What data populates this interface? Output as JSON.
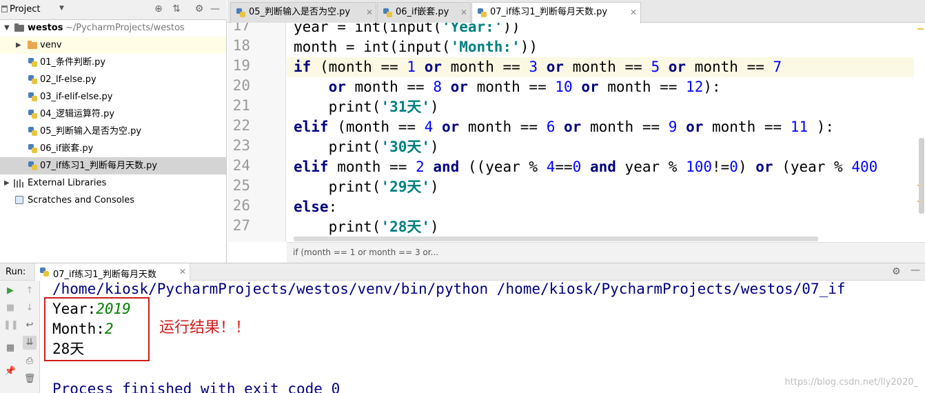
{
  "project_panel": {
    "title": "Project",
    "tree": [
      {
        "label": "westos",
        "suffix": "~/PycharmProjects/westos",
        "kind": "root"
      },
      {
        "label": "venv",
        "kind": "folder"
      },
      {
        "label": "01_条件判断.py",
        "kind": "file"
      },
      {
        "label": "02_lf-else.py",
        "kind": "file"
      },
      {
        "label": "03_if-elif-else.py",
        "kind": "file"
      },
      {
        "label": "04_逻辑运算符.py",
        "kind": "file"
      },
      {
        "label": "05_判断输入是否为空.py",
        "kind": "file"
      },
      {
        "label": "06_if嵌套.py",
        "kind": "file"
      },
      {
        "label": "07_if练习1_判断每月天数.py",
        "kind": "file",
        "selected": true
      },
      {
        "label": "External Libraries",
        "kind": "libraries"
      },
      {
        "label": "Scratches and Consoles",
        "kind": "scratches"
      }
    ]
  },
  "editor": {
    "tabs": [
      {
        "label": "05_判断输入是否为空.py",
        "active": false
      },
      {
        "label": "06_if嵌套.py",
        "active": false
      },
      {
        "label": "07_if练习1_判断每月天数.py",
        "active": true
      }
    ],
    "line_numbers": [
      "17",
      "18",
      "19",
      "20",
      "21",
      "22",
      "23",
      "24",
      "25",
      "26",
      "27"
    ],
    "breadcrumb": "if (month == 1 or month == 3 or..."
  },
  "run_panel": {
    "label": "Run:",
    "tab_label": "07_if练习1_判断每月天数",
    "console": {
      "command": "/home/kiosk/PycharmProjects/westos/venv/bin/python /home/kiosk/PycharmProjects/westos/07_if",
      "year_prompt": "Year:",
      "year_value": "2019",
      "month_prompt": "Month:",
      "month_value": "2",
      "result": "28天",
      "exit_message": "Process finished with exit code 0"
    },
    "annotation": "运行结果！！",
    "watermark": "https://blog.csdn.net/lly2020_"
  },
  "colors": {
    "keyword": "#000080",
    "number": "#0000ff",
    "string": "#008080",
    "input": "#008000",
    "annotation": "#d0201f"
  }
}
